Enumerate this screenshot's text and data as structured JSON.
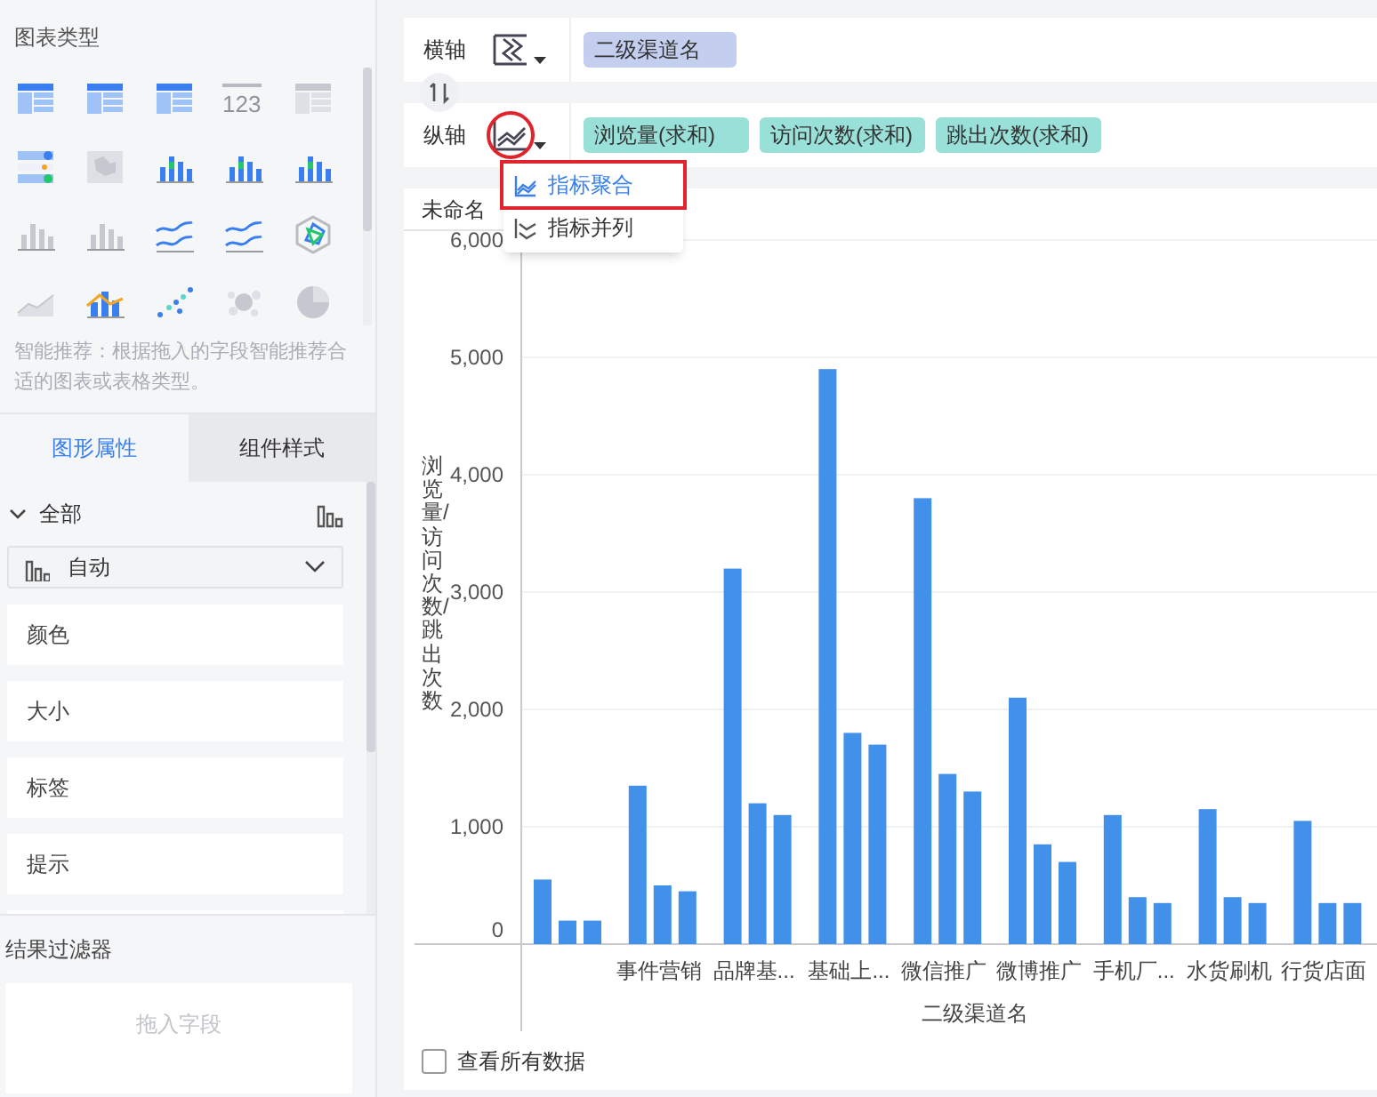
{
  "chart_types": {
    "title": "图表类型",
    "items": [
      {
        "kind": "table",
        "disabled": false
      },
      {
        "kind": "table",
        "disabled": false
      },
      {
        "kind": "table",
        "disabled": false
      },
      {
        "kind": "number",
        "label": "123",
        "disabled": true
      },
      {
        "kind": "table",
        "disabled": true
      },
      {
        "kind": "list",
        "disabled": false
      },
      {
        "kind": "map",
        "disabled": true
      },
      {
        "kind": "bars",
        "disabled": false
      },
      {
        "kind": "bars",
        "disabled": false
      },
      {
        "kind": "bars",
        "disabled": false
      },
      {
        "kind": "bars",
        "disabled": true
      },
      {
        "kind": "bars",
        "disabled": true
      },
      {
        "kind": "line",
        "disabled": false
      },
      {
        "kind": "line",
        "disabled": false
      },
      {
        "kind": "radar",
        "disabled": false
      },
      {
        "kind": "area",
        "disabled": true
      },
      {
        "kind": "combo",
        "disabled": false
      },
      {
        "kind": "scatter",
        "disabled": false
      },
      {
        "kind": "bubble",
        "disabled": true
      },
      {
        "kind": "pie",
        "disabled": true
      }
    ],
    "hint": "智能推荐：根据拖入的字段智能推荐合适的图表或表格类型。"
  },
  "tabs": [
    {
      "label": "图形属性",
      "selected": true
    },
    {
      "label": "组件样式",
      "selected": false
    }
  ],
  "properties": {
    "group": "全部",
    "expanded": true,
    "mark_type": "自动",
    "rows": [
      "颜色",
      "大小",
      "标签",
      "提示"
    ]
  },
  "result_filter": {
    "title": "结果过滤器",
    "placeholder": "拖入字段"
  },
  "axes": [
    {
      "label": "横轴",
      "circled": false,
      "fields": [
        {
          "label": "二级渠道名"
        }
      ]
    },
    {
      "label": "纵轴",
      "circled": true,
      "fields": [
        {
          "label": "浏览量(求和)"
        },
        {
          "label": "访问次数(求和)"
        },
        {
          "label": "跳出次数(求和)"
        }
      ]
    }
  ],
  "menu": [
    {
      "label": "指标聚合",
      "selected": true,
      "highlighted": true
    },
    {
      "label": "指标并列",
      "selected": false,
      "highlighted": false
    }
  ],
  "component": {
    "title": "未命名",
    "chart_data": {
      "type": "bar",
      "xlabel": "二级渠道名",
      "ylabel": "浏览量/访问次数/跳出次数",
      "categories": [
        null,
        "事件营销",
        "品牌基...",
        "基础上...",
        "微信推广",
        "微博推广",
        "手机厂...",
        "水货刷机",
        "行货店面"
      ],
      "series": [
        {
          "color": "#4190ea",
          "values": [
            550,
            1350,
            3200,
            4900,
            3800,
            2100,
            1100,
            1150,
            1050
          ]
        },
        {
          "color": "#4190ea",
          "values": [
            200,
            500,
            1200,
            1800,
            1450,
            850,
            400,
            400,
            350
          ]
        },
        {
          "color": "#4190ea",
          "values": [
            200,
            450,
            1100,
            1700,
            1300,
            700,
            350,
            350,
            350
          ]
        }
      ],
      "ylim": [
        0,
        6000
      ],
      "grid": true,
      "yticks": [
        {
          "value": 0,
          "label": "0"
        },
        {
          "value": 1000,
          "label": "1,000"
        },
        {
          "value": 2000,
          "label": "2,000"
        },
        {
          "value": 3000,
          "label": "3,000"
        },
        {
          "value": 4000,
          "label": "4,000"
        },
        {
          "value": 5000,
          "label": "5,000"
        },
        {
          "value": 6000,
          "label": "6,000"
        }
      ]
    },
    "show_all": {
      "label": "查看所有数据",
      "checked": false
    }
  }
}
